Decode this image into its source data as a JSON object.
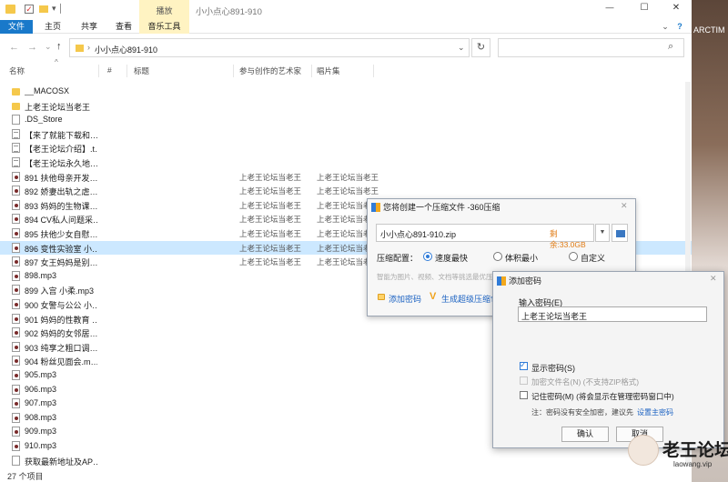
{
  "window": {
    "qat_label": "▾ │",
    "context_tab": "播放",
    "title": "小小点心891-910",
    "controls": {
      "minimize": "—",
      "maximize": "☐",
      "close": "✕"
    },
    "far_right_label": "ARCTIM"
  },
  "ribbon": {
    "tabs": [
      "文件",
      "主页",
      "共享",
      "查看",
      "音乐工具"
    ],
    "expand_glyph": "⌄",
    "help_glyph": "?"
  },
  "address": {
    "back": "←",
    "forward": "→",
    "recent": "⌄",
    "up": "↑",
    "path": "小小点心891-910",
    "path_sep": "›",
    "dropdown": "⌄",
    "refresh": "↻",
    "search_icon": "⌕",
    "search_placeholder": ""
  },
  "columns": {
    "name": "名称",
    "number": "#",
    "title": "标题",
    "artist": "参与创作的艺术家",
    "album": "唱片集",
    "sort_glyph": "^"
  },
  "files": [
    {
      "name": "__MACOSX",
      "type": "folder",
      "artist": "",
      "album": ""
    },
    {
      "name": "上老王论坛当老王",
      "type": "folder",
      "artist": "",
      "album": ""
    },
    {
      "name": ".DS_Store",
      "type": "doc",
      "artist": "",
      "album": ""
    },
    {
      "name": "【来了就能下载和…",
      "type": "txt",
      "artist": "",
      "album": ""
    },
    {
      "name": "【老王论坛介绍】.t…",
      "type": "txt",
      "artist": "",
      "album": ""
    },
    {
      "name": "【老王论坛永久地…",
      "type": "txt",
      "artist": "",
      "album": ""
    },
    {
      "name": "891 扶他母亲开发…",
      "type": "mp3",
      "artist": "上老王论坛当老王",
      "album": "上老王论坛当老王"
    },
    {
      "name": "892 娇妻出轨之虐…",
      "type": "mp3",
      "artist": "上老王论坛当老王",
      "album": "上老王论坛当老王"
    },
    {
      "name": "893 妈妈的生物课…",
      "type": "mp3",
      "artist": "上老王论坛当老王",
      "album": "上老王论坛当老王"
    },
    {
      "name": "894 CV私人问题采…",
      "type": "mp3",
      "artist": "上老王论坛当老王",
      "album": "上老王论坛当老王"
    },
    {
      "name": "895 扶他少女自慰…",
      "type": "mp3",
      "artist": "上老王论坛当老王",
      "album": "上老王论坛当老王"
    },
    {
      "name": "896 变性实验室 小…",
      "type": "mp3",
      "artist": "上老王论坛当老王",
      "album": "上老王论坛当老王",
      "selected": true
    },
    {
      "name": "897 女王妈妈是别…",
      "type": "mp3",
      "artist": "上老王论坛当老王",
      "album": "上老王论坛当老王"
    },
    {
      "name": "898.mp3",
      "type": "mp3",
      "artist": "",
      "album": ""
    },
    {
      "name": "899 入宫 小柔.mp3",
      "type": "mp3",
      "artist": "",
      "album": ""
    },
    {
      "name": "900 女警与公公 小…",
      "type": "mp3",
      "artist": "",
      "album": ""
    },
    {
      "name": "901 妈妈的性教育 …",
      "type": "mp3",
      "artist": "",
      "album": ""
    },
    {
      "name": "902 妈妈的女邻居…",
      "type": "mp3",
      "artist": "",
      "album": ""
    },
    {
      "name": "903 纯享之粗口调…",
      "type": "mp3",
      "artist": "",
      "album": ""
    },
    {
      "name": "904 粉丝见面会.m…",
      "type": "mp3",
      "artist": "",
      "album": ""
    },
    {
      "name": "905.mp3",
      "type": "mp3",
      "artist": "",
      "album": ""
    },
    {
      "name": "906.mp3",
      "type": "mp3",
      "artist": "",
      "album": ""
    },
    {
      "name": "907.mp3",
      "type": "mp3",
      "artist": "",
      "album": ""
    },
    {
      "name": "908.mp3",
      "type": "mp3",
      "artist": "",
      "album": ""
    },
    {
      "name": "909.mp3",
      "type": "mp3",
      "artist": "",
      "album": ""
    },
    {
      "name": "910.mp3",
      "type": "mp3",
      "artist": "",
      "album": ""
    },
    {
      "name": "获取最新地址及AP…",
      "type": "doc",
      "artist": "",
      "album": ""
    }
  ],
  "status": {
    "count": "27 个项目"
  },
  "compress_dialog": {
    "title": "您将创建一个压缩文件 -360压缩",
    "close": "✕",
    "filename": "小小点心891-910.zip",
    "remaining": "剩余:33.0GB",
    "dropdown": "▼",
    "config_label": "压缩配置：",
    "options": [
      "速度最快",
      "体积最小",
      "自定义"
    ],
    "hint": "智能为图片、视频、文档等挑选最优压缩方法",
    "add_password": "添加密码",
    "self_extract": "生成超级压缩包"
  },
  "password_dialog": {
    "title": "添加密码",
    "close": "✕",
    "input_label": "输入密码(E)",
    "password_value": "上老王论坛当老王",
    "show_password": "显示密码(S)",
    "encrypt_names": "加密文件名(N) (不支持ZIP格式)",
    "remember": "记住密码(M) (将会显示在管理密码窗口中)",
    "note": "注：密码没有安全加密，建议先",
    "note_link": "设置主密码",
    "ok": "确认",
    "cancel": "取消"
  },
  "watermark": {
    "brand": "老王论坛",
    "url": "laowang.vip"
  },
  "colors": {
    "ribbon_accent": "#fff3c2",
    "file_tab": "#1979ca",
    "selection": "#cce8ff",
    "link": "#1b62c2"
  }
}
